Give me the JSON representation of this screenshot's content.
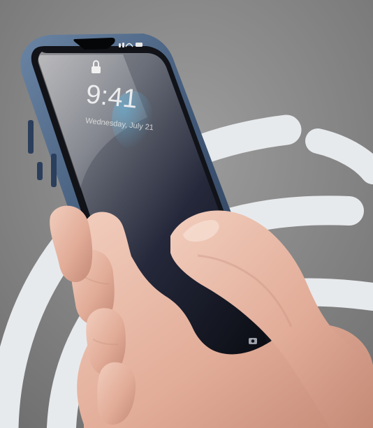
{
  "lockscreen": {
    "time": "9:41",
    "date": "Wednesday, July 21"
  },
  "colors": {
    "background": "#8c8c8c",
    "rings": "#e8ebee",
    "frame": "#3f5573",
    "screen": "#1b1d27",
    "skin": "#e7b9a6"
  },
  "icons": {
    "lock": "lock-icon",
    "status": "status-icons",
    "flashlight": "flashlight-icon",
    "camera": "camera-icon"
  }
}
